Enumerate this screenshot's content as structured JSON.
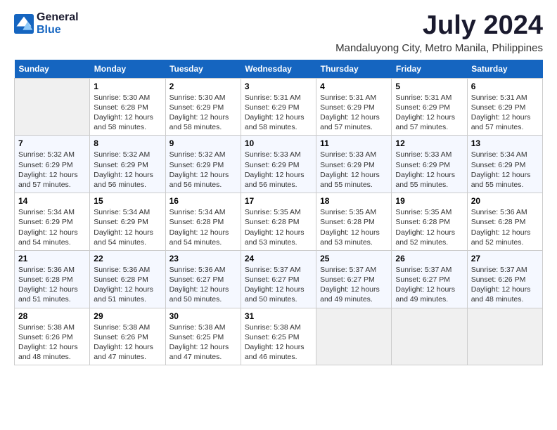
{
  "logo": {
    "general": "General",
    "blue": "Blue"
  },
  "title": "July 2024",
  "location": "Mandaluyong City, Metro Manila, Philippines",
  "weekdays": [
    "Sunday",
    "Monday",
    "Tuesday",
    "Wednesday",
    "Thursday",
    "Friday",
    "Saturday"
  ],
  "weeks": [
    [
      {
        "day": "",
        "info": ""
      },
      {
        "day": "1",
        "info": "Sunrise: 5:30 AM\nSunset: 6:28 PM\nDaylight: 12 hours\nand 58 minutes."
      },
      {
        "day": "2",
        "info": "Sunrise: 5:30 AM\nSunset: 6:29 PM\nDaylight: 12 hours\nand 58 minutes."
      },
      {
        "day": "3",
        "info": "Sunrise: 5:31 AM\nSunset: 6:29 PM\nDaylight: 12 hours\nand 58 minutes."
      },
      {
        "day": "4",
        "info": "Sunrise: 5:31 AM\nSunset: 6:29 PM\nDaylight: 12 hours\nand 57 minutes."
      },
      {
        "day": "5",
        "info": "Sunrise: 5:31 AM\nSunset: 6:29 PM\nDaylight: 12 hours\nand 57 minutes."
      },
      {
        "day": "6",
        "info": "Sunrise: 5:31 AM\nSunset: 6:29 PM\nDaylight: 12 hours\nand 57 minutes."
      }
    ],
    [
      {
        "day": "7",
        "info": "Sunrise: 5:32 AM\nSunset: 6:29 PM\nDaylight: 12 hours\nand 57 minutes."
      },
      {
        "day": "8",
        "info": "Sunrise: 5:32 AM\nSunset: 6:29 PM\nDaylight: 12 hours\nand 56 minutes."
      },
      {
        "day": "9",
        "info": "Sunrise: 5:32 AM\nSunset: 6:29 PM\nDaylight: 12 hours\nand 56 minutes."
      },
      {
        "day": "10",
        "info": "Sunrise: 5:33 AM\nSunset: 6:29 PM\nDaylight: 12 hours\nand 56 minutes."
      },
      {
        "day": "11",
        "info": "Sunrise: 5:33 AM\nSunset: 6:29 PM\nDaylight: 12 hours\nand 55 minutes."
      },
      {
        "day": "12",
        "info": "Sunrise: 5:33 AM\nSunset: 6:29 PM\nDaylight: 12 hours\nand 55 minutes."
      },
      {
        "day": "13",
        "info": "Sunrise: 5:34 AM\nSunset: 6:29 PM\nDaylight: 12 hours\nand 55 minutes."
      }
    ],
    [
      {
        "day": "14",
        "info": "Sunrise: 5:34 AM\nSunset: 6:29 PM\nDaylight: 12 hours\nand 54 minutes."
      },
      {
        "day": "15",
        "info": "Sunrise: 5:34 AM\nSunset: 6:29 PM\nDaylight: 12 hours\nand 54 minutes."
      },
      {
        "day": "16",
        "info": "Sunrise: 5:34 AM\nSunset: 6:28 PM\nDaylight: 12 hours\nand 54 minutes."
      },
      {
        "day": "17",
        "info": "Sunrise: 5:35 AM\nSunset: 6:28 PM\nDaylight: 12 hours\nand 53 minutes."
      },
      {
        "day": "18",
        "info": "Sunrise: 5:35 AM\nSunset: 6:28 PM\nDaylight: 12 hours\nand 53 minutes."
      },
      {
        "day": "19",
        "info": "Sunrise: 5:35 AM\nSunset: 6:28 PM\nDaylight: 12 hours\nand 52 minutes."
      },
      {
        "day": "20",
        "info": "Sunrise: 5:36 AM\nSunset: 6:28 PM\nDaylight: 12 hours\nand 52 minutes."
      }
    ],
    [
      {
        "day": "21",
        "info": "Sunrise: 5:36 AM\nSunset: 6:28 PM\nDaylight: 12 hours\nand 51 minutes."
      },
      {
        "day": "22",
        "info": "Sunrise: 5:36 AM\nSunset: 6:28 PM\nDaylight: 12 hours\nand 51 minutes."
      },
      {
        "day": "23",
        "info": "Sunrise: 5:36 AM\nSunset: 6:27 PM\nDaylight: 12 hours\nand 50 minutes."
      },
      {
        "day": "24",
        "info": "Sunrise: 5:37 AM\nSunset: 6:27 PM\nDaylight: 12 hours\nand 50 minutes."
      },
      {
        "day": "25",
        "info": "Sunrise: 5:37 AM\nSunset: 6:27 PM\nDaylight: 12 hours\nand 49 minutes."
      },
      {
        "day": "26",
        "info": "Sunrise: 5:37 AM\nSunset: 6:27 PM\nDaylight: 12 hours\nand 49 minutes."
      },
      {
        "day": "27",
        "info": "Sunrise: 5:37 AM\nSunset: 6:26 PM\nDaylight: 12 hours\nand 48 minutes."
      }
    ],
    [
      {
        "day": "28",
        "info": "Sunrise: 5:38 AM\nSunset: 6:26 PM\nDaylight: 12 hours\nand 48 minutes."
      },
      {
        "day": "29",
        "info": "Sunrise: 5:38 AM\nSunset: 6:26 PM\nDaylight: 12 hours\nand 47 minutes."
      },
      {
        "day": "30",
        "info": "Sunrise: 5:38 AM\nSunset: 6:25 PM\nDaylight: 12 hours\nand 47 minutes."
      },
      {
        "day": "31",
        "info": "Sunrise: 5:38 AM\nSunset: 6:25 PM\nDaylight: 12 hours\nand 46 minutes."
      },
      {
        "day": "",
        "info": ""
      },
      {
        "day": "",
        "info": ""
      },
      {
        "day": "",
        "info": ""
      }
    ]
  ]
}
